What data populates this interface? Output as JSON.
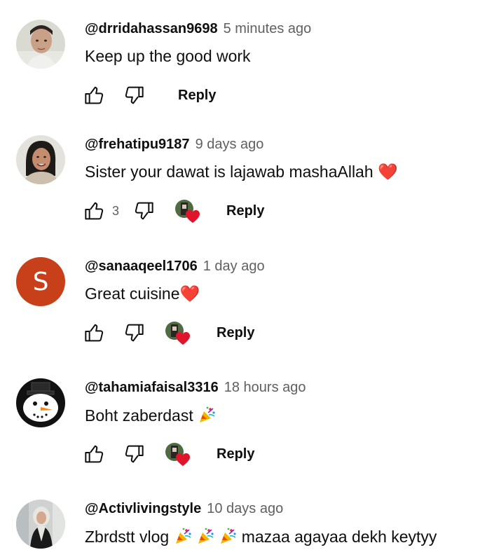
{
  "colors": {
    "text_primary": "#0f0f0f",
    "text_secondary": "#606060",
    "heart_red": "#e0152b",
    "letter_avatar_bg": "#c8401a"
  },
  "comments": [
    {
      "handle": "@drridahassan9698",
      "time": "5 minutes ago",
      "text": "Keep up the good work",
      "like_count": "",
      "creator_hearted": false,
      "reply_label": "Reply",
      "avatar": "child-photo"
    },
    {
      "handle": "@frehatipu9187",
      "time": "9 days ago",
      "text": "Sister your dawat is lajawab mashaAllah",
      "text_emoji": "❤️",
      "like_count": "3",
      "creator_hearted": true,
      "reply_label": "Reply",
      "avatar": "woman-photo"
    },
    {
      "handle": "@sanaaqeel1706",
      "time": "1 day ago",
      "text": "Great cuisine",
      "text_emoji": "❤️",
      "like_count": "",
      "creator_hearted": true,
      "reply_label": "Reply",
      "avatar": "letter",
      "avatar_letter": "S"
    },
    {
      "handle": "@tahamiafaisal3316",
      "time": "18 hours ago",
      "text": "Boht zaberdast",
      "text_emoji": "party-popper",
      "like_count": "",
      "creator_hearted": true,
      "reply_label": "Reply",
      "avatar": "snowman"
    },
    {
      "handle": "@Activlivingstyle",
      "time": "10 days ago",
      "text_parts": [
        "Zbrdstt vlog",
        "mazaa agayaa dekh keytyy"
      ],
      "text_emoji": "party-popper",
      "avatar": "woman-hijab-photo"
    }
  ]
}
